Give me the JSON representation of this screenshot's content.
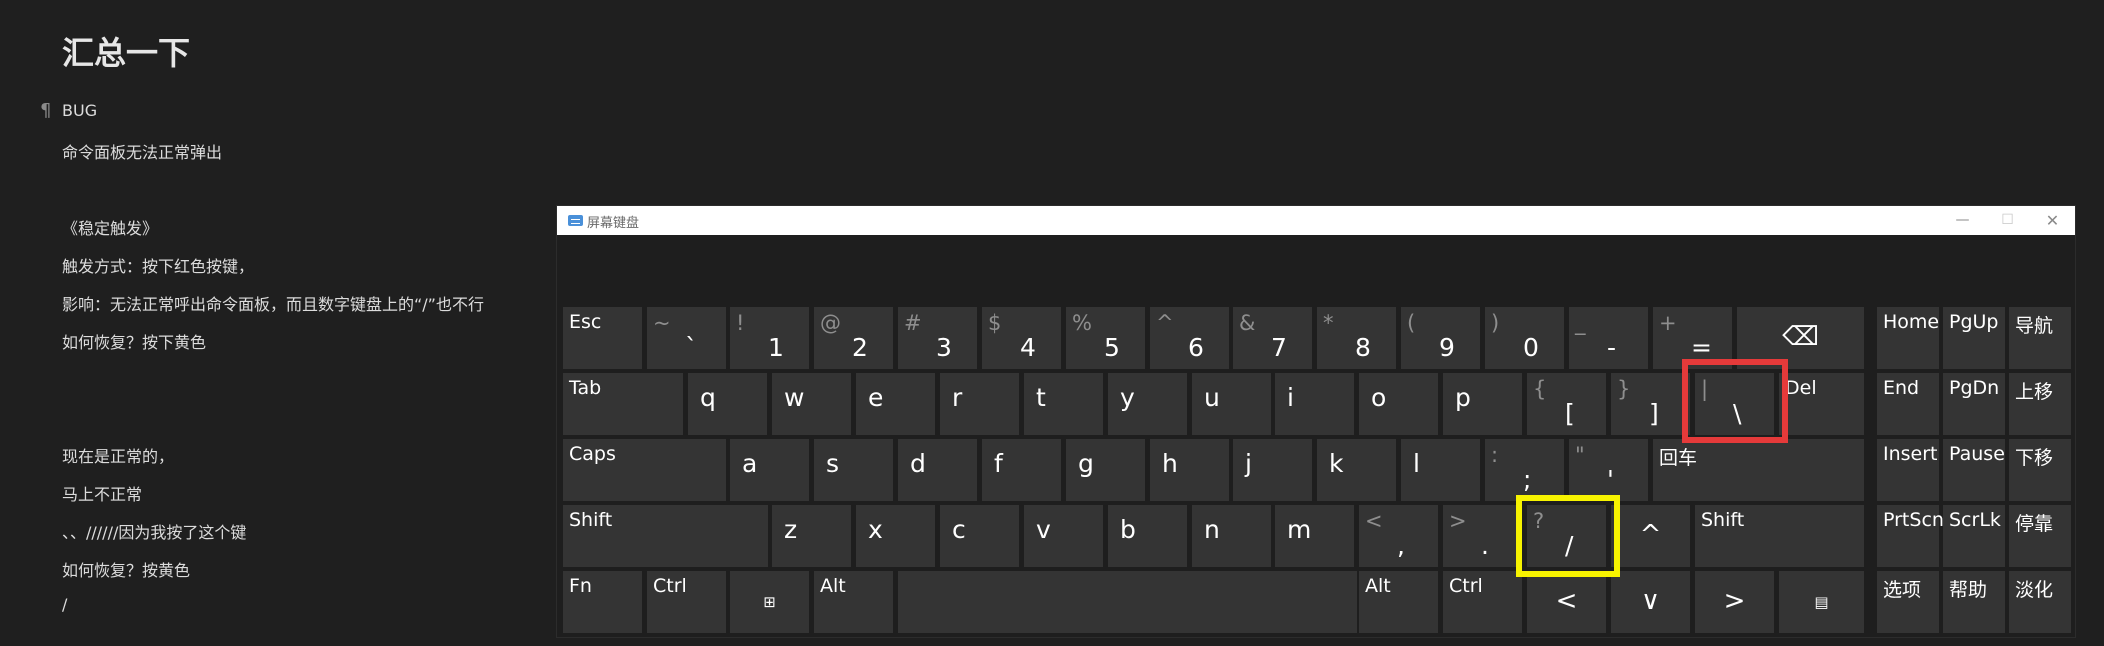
{
  "note": {
    "title": "汇总一下",
    "pilcrow": "¶",
    "lines": [
      "BUG",
      "命令面板无法正常弹出",
      "《稳定触发》",
      "触发方式：按下红色按键，",
      "影响：无法正常呼出命令面板，而且数字键盘上的“/”也不行",
      "如何恢复？按下黄色",
      "现在是正常的，",
      "马上不正常",
      "、、//////因为我按了这个键",
      "如何恢复？按黄色",
      "/"
    ]
  },
  "osk": {
    "title": "屏幕键盘",
    "window_controls": {
      "minimize": "—",
      "maximize": "☐",
      "close": "✕"
    },
    "rows": [
      [
        {
          "label": "Esc"
        },
        {
          "shift": "~",
          "main": "`"
        },
        {
          "shift": "!",
          "main": "1"
        },
        {
          "shift": "@",
          "main": "2"
        },
        {
          "shift": "#",
          "main": "3"
        },
        {
          "shift": "$",
          "main": "4"
        },
        {
          "shift": "%",
          "main": "5"
        },
        {
          "shift": "^",
          "main": "6"
        },
        {
          "shift": "&",
          "main": "7"
        },
        {
          "shift": "*",
          "main": "8"
        },
        {
          "shift": "(",
          "main": "9"
        },
        {
          "shift": ")",
          "main": "0"
        },
        {
          "shift": "_",
          "main": "-"
        },
        {
          "shift": "+",
          "main": "="
        },
        {
          "icon": "backspace-icon",
          "glyph": "⌫"
        },
        {
          "label": "Home"
        },
        {
          "label": "PgUp"
        },
        {
          "label": "导航"
        }
      ],
      [
        {
          "label": "Tab"
        },
        {
          "single": "q"
        },
        {
          "single": "w"
        },
        {
          "single": "e"
        },
        {
          "single": "r"
        },
        {
          "single": "t"
        },
        {
          "single": "y"
        },
        {
          "single": "u"
        },
        {
          "single": "i"
        },
        {
          "single": "o"
        },
        {
          "single": "p"
        },
        {
          "shift": "{",
          "main": "["
        },
        {
          "shift": "}",
          "main": "]"
        },
        {
          "shift": "|",
          "main": "\\"
        },
        {
          "label": "Del"
        },
        {
          "label": "End"
        },
        {
          "label": "PgDn"
        },
        {
          "label": "上移"
        }
      ],
      [
        {
          "label": "Caps"
        },
        {
          "single": "a"
        },
        {
          "single": "s"
        },
        {
          "single": "d"
        },
        {
          "single": "f"
        },
        {
          "single": "g"
        },
        {
          "single": "h"
        },
        {
          "single": "j"
        },
        {
          "single": "k"
        },
        {
          "single": "l"
        },
        {
          "shift": ":",
          "main": ";"
        },
        {
          "shift": "\"",
          "main": "'"
        },
        {
          "label": "回车"
        },
        {
          "label": "Insert"
        },
        {
          "label": "Pause"
        },
        {
          "label": "下移"
        }
      ],
      [
        {
          "label": "Shift"
        },
        {
          "single": "z"
        },
        {
          "single": "x"
        },
        {
          "single": "c"
        },
        {
          "single": "v"
        },
        {
          "single": "b"
        },
        {
          "single": "n"
        },
        {
          "single": "m"
        },
        {
          "shift": "<",
          "main": ","
        },
        {
          "shift": ">",
          "main": "."
        },
        {
          "shift": "?",
          "main": "/"
        },
        {
          "icon": "arrow-up-icon",
          "glyph": "^"
        },
        {
          "label": "Shift"
        },
        {
          "label": "PrtScn"
        },
        {
          "label": "ScrLk"
        },
        {
          "label": "停靠"
        }
      ],
      [
        {
          "label": "Fn"
        },
        {
          "label": "Ctrl"
        },
        {
          "icon": "windows-icon",
          "glyph": "⊞"
        },
        {
          "label": "Alt"
        },
        {
          "label": ""
        },
        {
          "label": "Alt"
        },
        {
          "label": "Ctrl"
        },
        {
          "icon": "arrow-left-icon",
          "glyph": "<"
        },
        {
          "icon": "arrow-down-icon",
          "glyph": "∨"
        },
        {
          "icon": "arrow-right-icon",
          "glyph": ">"
        },
        {
          "icon": "menu-icon",
          "glyph": "▤"
        },
        {
          "label": "选项"
        },
        {
          "label": "帮助"
        },
        {
          "label": "淡化"
        }
      ]
    ],
    "highlights": {
      "red_key": "\\",
      "yellow_key": "/"
    }
  }
}
